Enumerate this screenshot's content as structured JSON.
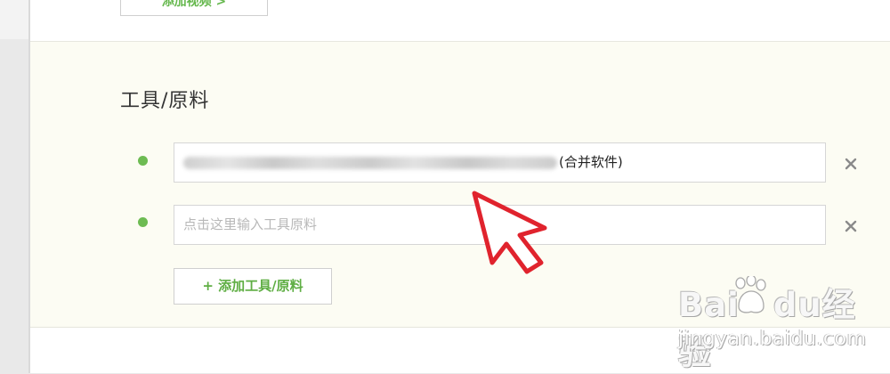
{
  "top_section": {
    "add_video_label": "添加视频 >"
  },
  "tools_section": {
    "title": "工具/原料",
    "items": [
      {
        "value_suffix": "(合并软件)",
        "placeholder": ""
      },
      {
        "value_suffix": "",
        "placeholder": "点击这里输入工具原料"
      }
    ],
    "remove_glyph": "×",
    "add_button_label": "+ 添加工具/原料"
  },
  "watermark": {
    "brand": "Bai du 经验",
    "brand_left": "Bai",
    "brand_right": "du",
    "brand_cn": "经验",
    "url": "jingyan.baidu.com"
  },
  "icons": {
    "bullet": "green-dot-icon",
    "remove": "close-icon",
    "cursor": "red-arrow-cursor-icon"
  },
  "colors": {
    "accent_green": "#6dbb52",
    "cursor_red": "#e0232d",
    "panel_bg": "#fcfcf3"
  }
}
